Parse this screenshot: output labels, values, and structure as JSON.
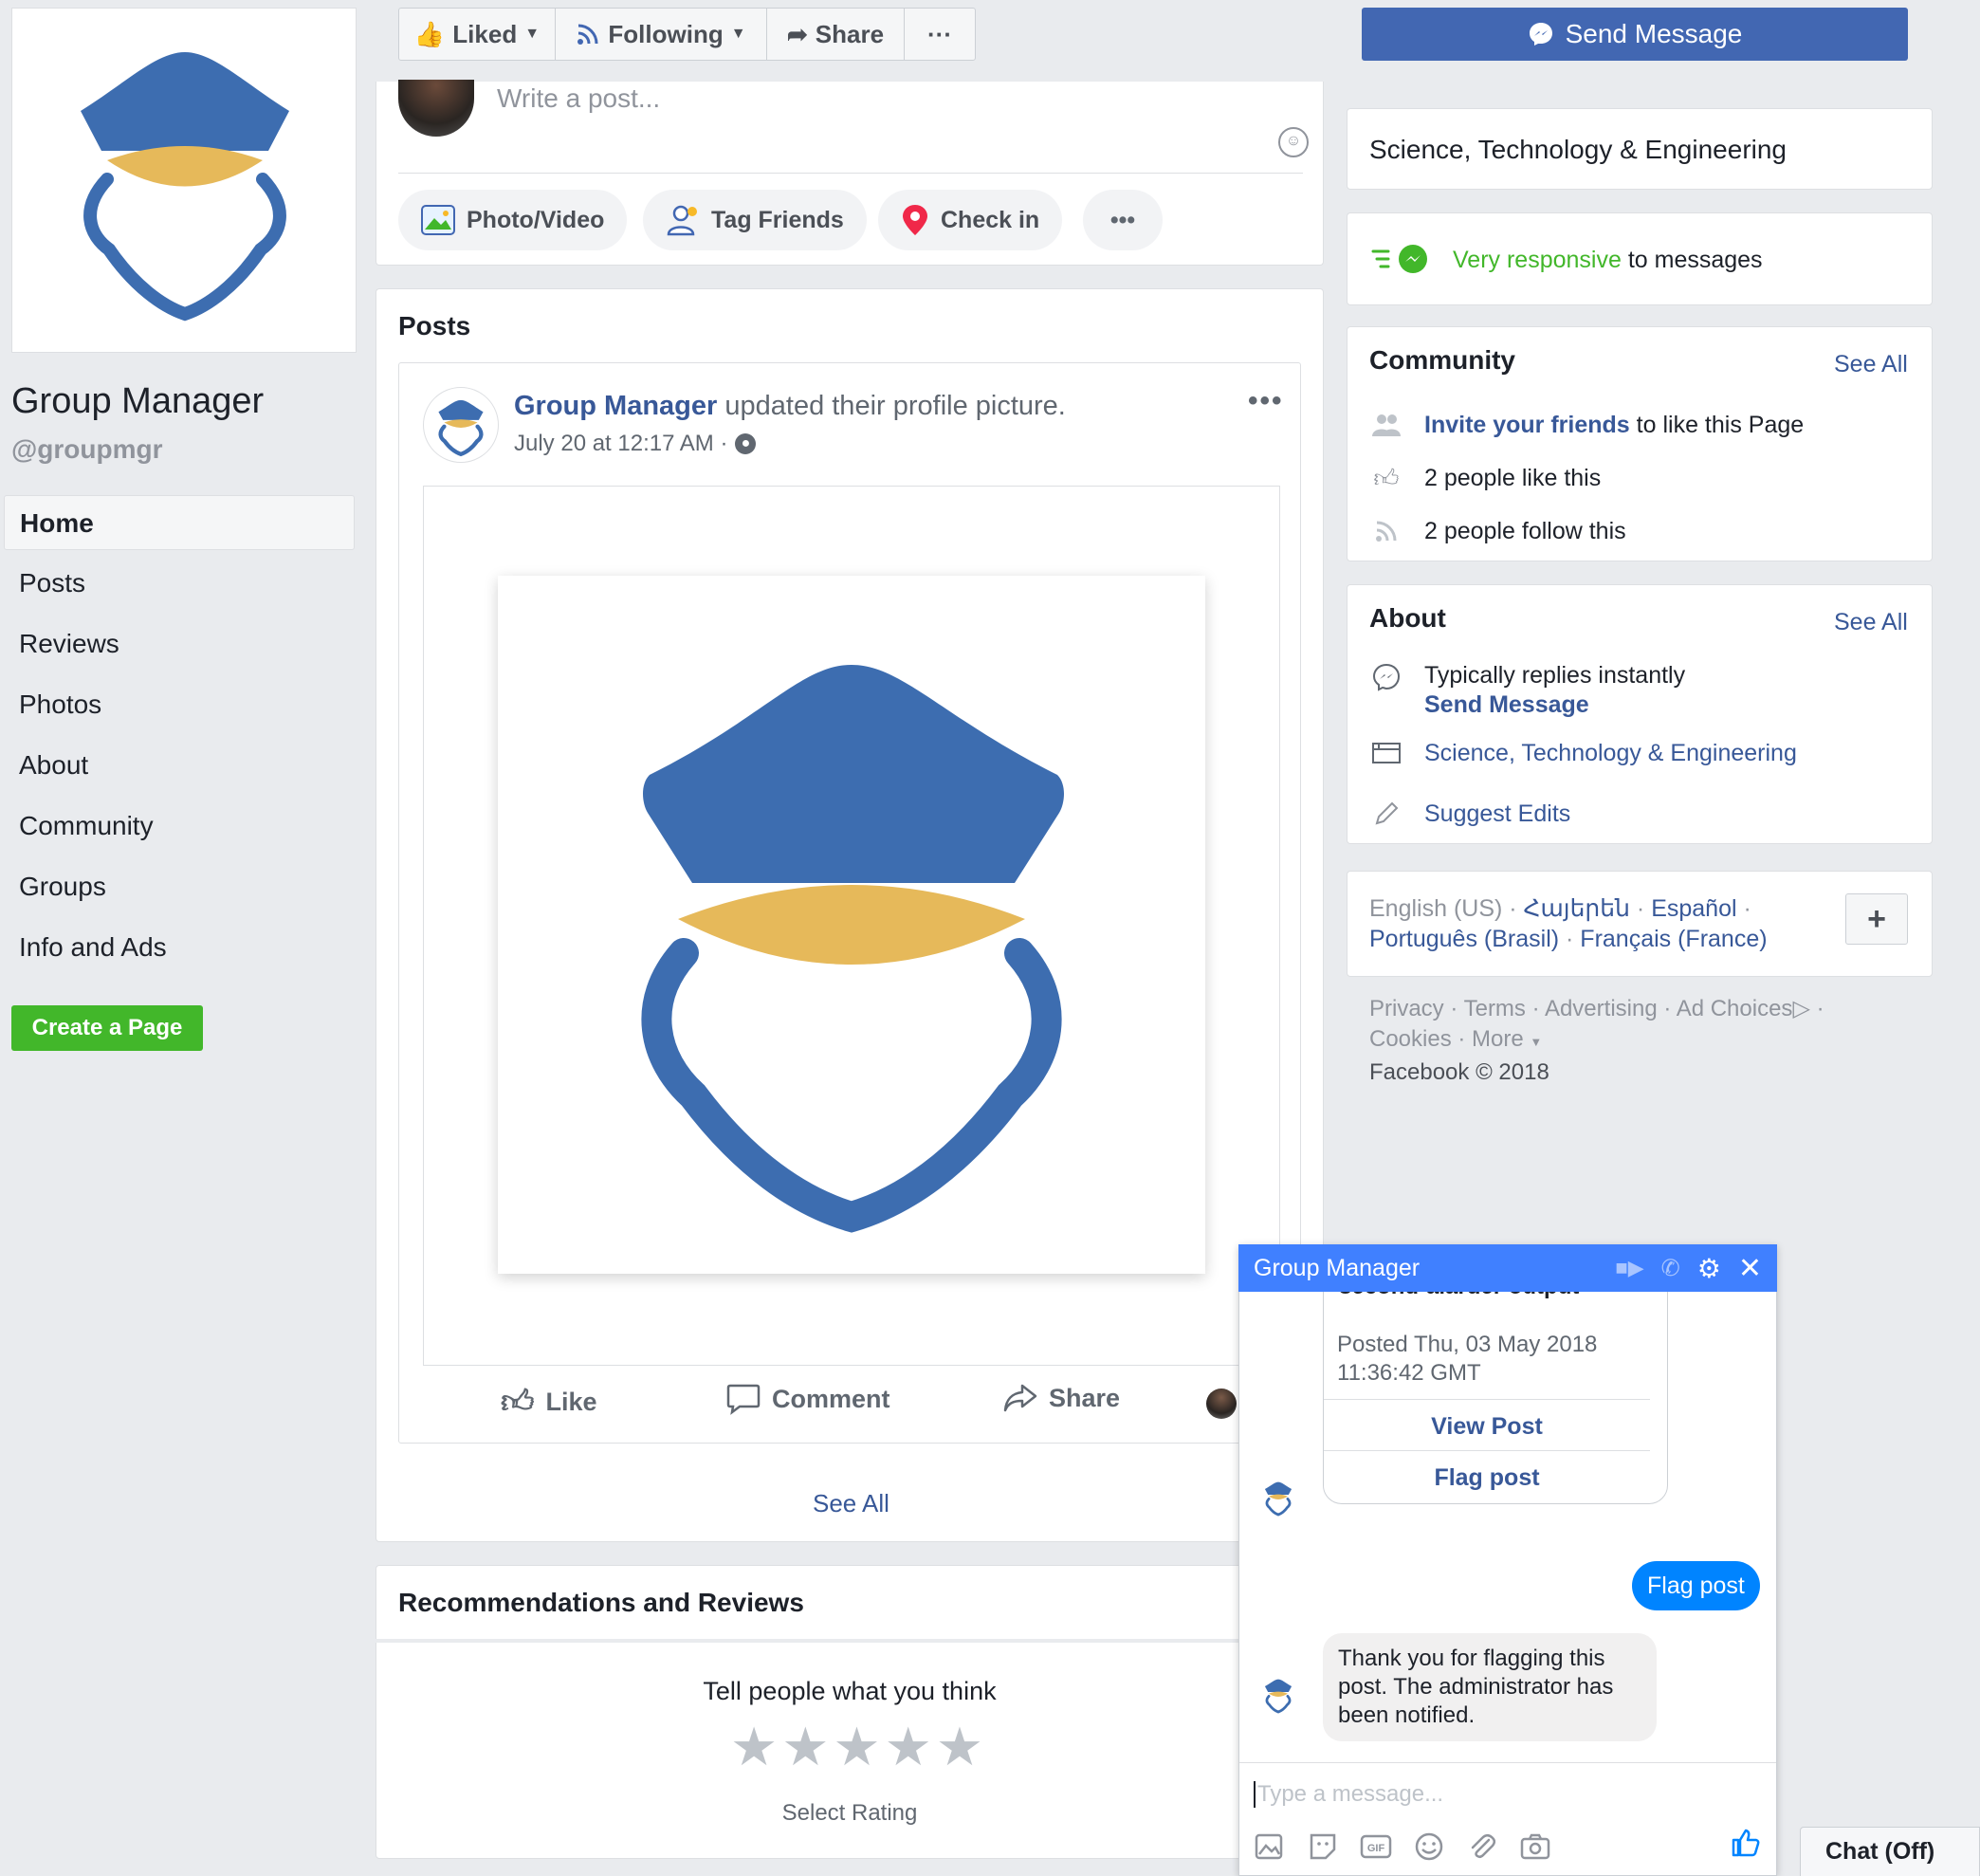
{
  "page": {
    "name": "Group Manager",
    "handle": "@groupmgr"
  },
  "leftnav": {
    "items": [
      "Home",
      "Posts",
      "Reviews",
      "Photos",
      "About",
      "Community",
      "Groups",
      "Info and Ads"
    ],
    "create_page": "Create a Page"
  },
  "topbar": {
    "liked": "Liked",
    "following": "Following",
    "share": "Share",
    "more": "···",
    "send_message": "Send Message"
  },
  "composer": {
    "placeholder": "Write a post...",
    "photo_video": "Photo/Video",
    "tag_friends": "Tag Friends",
    "check_in": "Check in",
    "more": "•••"
  },
  "posts": {
    "heading": "Posts",
    "author": "Group Manager",
    "action_text": " updated their profile picture.",
    "timestamp": "July 20 at 12:17 AM ·",
    "like": "Like",
    "comment": "Comment",
    "share": "Share",
    "see_all": "See All"
  },
  "reviews": {
    "heading": "Recommendations and Reviews",
    "prompt": "Tell people what you think",
    "select_rating": "Select Rating",
    "stars": 5
  },
  "sidebar": {
    "category": "Science, Technology & Engineering",
    "responsive_strong": "Very responsive",
    "responsive_rest": " to messages",
    "community": {
      "title": "Community",
      "see_all": "See All",
      "invite_strong": "Invite your friends",
      "invite_rest": " to like this Page",
      "likes": "2 people like this",
      "follows": "2 people follow this"
    },
    "about": {
      "title": "About",
      "see_all": "See All",
      "replies": "Typically replies instantly",
      "send_message": "Send Message",
      "category": "Science, Technology & Engineering",
      "suggest_edits": "Suggest Edits"
    },
    "languages": {
      "current": "English (US)",
      "sep": " · ",
      "armenian": "Հայերեն",
      "spanish": "Español",
      "portuguese": "Português (Brasil)",
      "french": "Français (France)",
      "add": "+"
    },
    "footer": {
      "privacy": "Privacy",
      "terms": "Terms",
      "advertising": "Advertising",
      "ad_choices": "Ad Choices",
      "cookies": "Cookies",
      "more": "More",
      "copyright": "Facebook © 2018"
    }
  },
  "chat": {
    "title": "Group Manager",
    "cut_text": "second-alarder output",
    "posted": "Posted Thu, 03 May 2018 11:36:42 GMT",
    "view_post": "View Post",
    "flag_post_option": "Flag post",
    "user_message": "Flag post",
    "bot_reply": "Thank you for flagging this post. The administrator has been notified.",
    "input_placeholder": "Type a message...",
    "chat_status": "Chat (Off)"
  },
  "colors": {
    "facebook_blue": "#4267b2",
    "link_blue": "#385898",
    "green": "#42b72a",
    "logo_blue": "#3d6db0",
    "logo_gold": "#e6b95a",
    "messenger_blue": "#4080ff"
  }
}
